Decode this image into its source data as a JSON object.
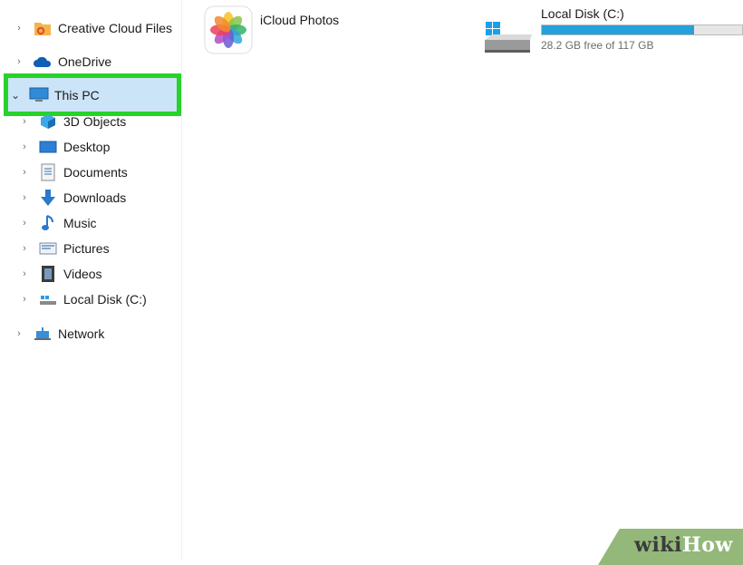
{
  "nav": {
    "items": [
      {
        "label": "Creative Cloud Files",
        "chevron": ">",
        "icon": "creative-cloud-folder-icon"
      },
      {
        "label": "OneDrive",
        "chevron": ">",
        "icon": "onedrive-cloud-icon"
      },
      {
        "label": "This PC",
        "chevron": "v",
        "icon": "monitor-icon",
        "selected": true
      },
      {
        "label": "3D Objects",
        "chevron": ">",
        "icon": "3d-objects-icon"
      },
      {
        "label": "Desktop",
        "chevron": ">",
        "icon": "desktop-icon"
      },
      {
        "label": "Documents",
        "chevron": ">",
        "icon": "documents-icon"
      },
      {
        "label": "Downloads",
        "chevron": ">",
        "icon": "downloads-icon"
      },
      {
        "label": "Music",
        "chevron": ">",
        "icon": "music-icon"
      },
      {
        "label": "Pictures",
        "chevron": ">",
        "icon": "pictures-icon"
      },
      {
        "label": "Videos",
        "chevron": ">",
        "icon": "videos-icon"
      },
      {
        "label": "Local Disk (C:)",
        "chevron": ">",
        "icon": "drive-icon"
      },
      {
        "label": "Network",
        "chevron": ">",
        "icon": "network-icon"
      }
    ]
  },
  "content": {
    "icloud": {
      "label": "iCloud Photos",
      "icon": "icloud-photos-icon"
    },
    "disk": {
      "label": "Local Disk (C:)",
      "free_text": "28.2 GB free of 117 GB",
      "used_fraction": 0.76,
      "icon": "windows-drive-icon"
    }
  },
  "colors": {
    "selection": "#cce4f7",
    "highlight": "#27d22b",
    "disk_fill": "#26a0da"
  },
  "watermark": {
    "wiki": "wiki",
    "how": "How"
  }
}
